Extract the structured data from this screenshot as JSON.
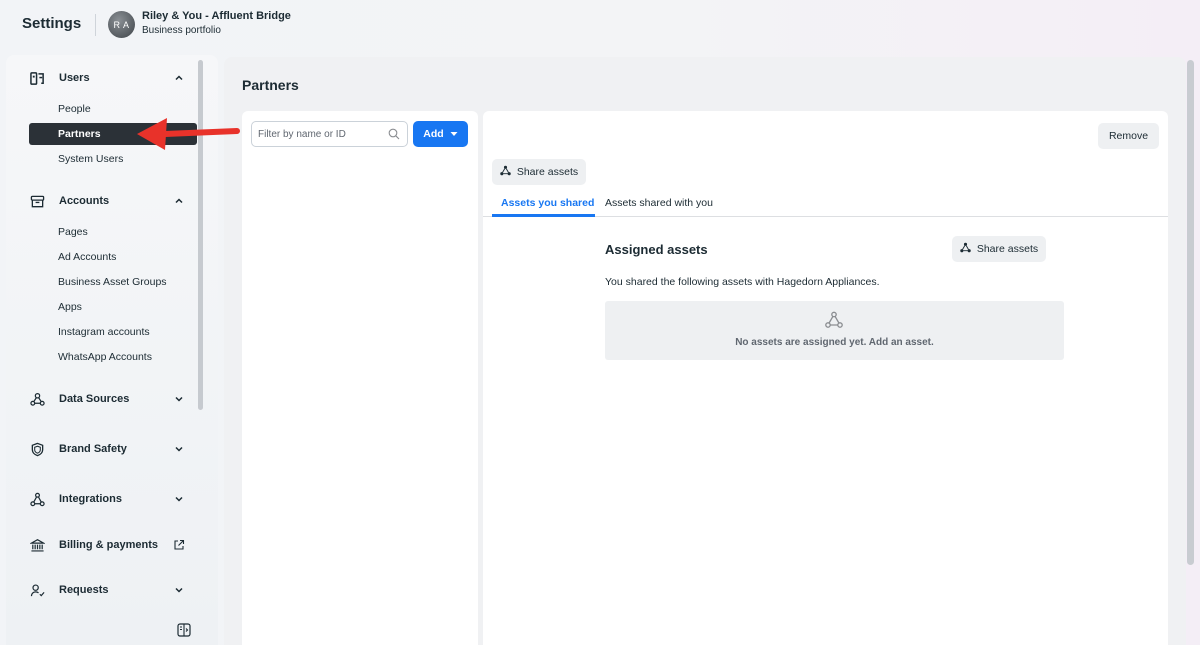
{
  "header": {
    "app_title": "Settings",
    "portfolio_initials": "R A",
    "portfolio_name": "Riley & You - Affluent Bridge",
    "portfolio_subtitle": "Business portfolio"
  },
  "sidebar": {
    "sections": [
      {
        "label": "Users",
        "expanded": true,
        "icon": "users-icon",
        "items": [
          "People",
          "Partners",
          "System Users"
        ],
        "active_item": "Partners"
      },
      {
        "label": "Accounts",
        "expanded": true,
        "icon": "accounts-icon",
        "items": [
          "Pages",
          "Ad Accounts",
          "Business Asset Groups",
          "Apps",
          "Instagram accounts",
          "WhatsApp Accounts"
        ]
      },
      {
        "label": "Data Sources",
        "expanded": false,
        "icon": "data-sources-icon"
      },
      {
        "label": "Brand Safety",
        "expanded": false,
        "icon": "shield-icon"
      },
      {
        "label": "Integrations",
        "expanded": false,
        "icon": "integrations-icon"
      },
      {
        "label": "Billing & payments",
        "expanded": false,
        "icon": "bank-icon",
        "external": true
      },
      {
        "label": "Requests",
        "expanded": false,
        "icon": "requests-icon"
      }
    ]
  },
  "main": {
    "title": "Partners",
    "filter": {
      "placeholder": "Filter by name or ID"
    },
    "add_label": "Add",
    "remove_label": "Remove",
    "share_assets_label": "Share assets",
    "tabs": [
      {
        "label": "Assets you shared",
        "active": true
      },
      {
        "label": "Assets shared with you",
        "active": false
      }
    ],
    "assigned": {
      "title": "Assigned assets",
      "share_label": "Share assets",
      "description": "You shared the following assets with Hagedorn Appliances.",
      "empty_text": "No assets are assigned yet. Add an asset."
    }
  },
  "colors": {
    "accent": "#1877f2",
    "active_nav": "#2b3137",
    "annotation_arrow": "#e8322a"
  }
}
